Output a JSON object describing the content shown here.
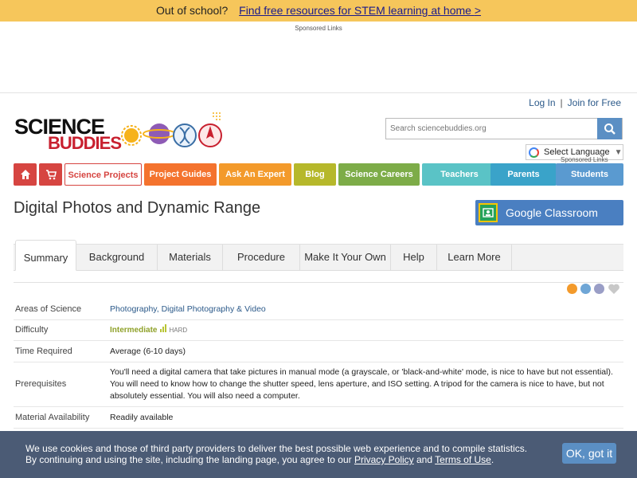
{
  "promo": {
    "prefix": "Out of school?",
    "link": "Find free resources for STEM learning at home",
    "arrow": ">"
  },
  "ads": {
    "sponsored_top": "Sponsored Links",
    "sponsored_mid": "Sponsored Links"
  },
  "header": {
    "login": "Log In",
    "separator": "|",
    "join": "Join for Free",
    "logo_word1": "SCIENCE",
    "logo_word2": "BUDDIES",
    "search_placeholder": "Search sciencebuddies.org",
    "language_label": "Select Language",
    "language_caret": "▼"
  },
  "nav": [
    {
      "id": "home",
      "label": "",
      "icon": "home-icon",
      "color": "#d64541"
    },
    {
      "id": "cart",
      "label": "",
      "icon": "cart-icon",
      "color": "#d64541"
    },
    {
      "id": "science-projects",
      "label": "Science Projects",
      "color": "#ffffff",
      "text_color": "#d64541"
    },
    {
      "id": "project-guides",
      "label": "Project Guides",
      "color": "#f4732e"
    },
    {
      "id": "ask-an-expert",
      "label": "Ask An Expert",
      "color": "#f39a2b"
    },
    {
      "id": "blog",
      "label": "Blog",
      "color": "#b6b82b"
    },
    {
      "id": "science-careers",
      "label": "Science Careers",
      "color": "#7dac48"
    },
    {
      "id": "teachers",
      "label": "Teachers",
      "color": "#5ac3c6"
    },
    {
      "id": "parents",
      "label": "Parents",
      "color": "#3aa3c9"
    },
    {
      "id": "students",
      "label": "Students",
      "color": "#5a9ad0"
    }
  ],
  "page": {
    "title": "Digital Photos and Dynamic Range",
    "google_classroom": "Google Classroom"
  },
  "tabs": [
    {
      "label": "Summary",
      "active": true
    },
    {
      "label": "Background"
    },
    {
      "label": "Materials"
    },
    {
      "label": "Procedure"
    },
    {
      "label": "Make It Your Own"
    },
    {
      "label": "Help"
    },
    {
      "label": "Learn More"
    }
  ],
  "share_icons": [
    "rss-icon",
    "print-icon",
    "email-icon",
    "heart-icon"
  ],
  "summary": {
    "areas_key": "Areas of Science",
    "areas_val": "Photography, Digital Photography & Video",
    "difficulty_key": "Difficulty",
    "difficulty_level": "Intermediate",
    "difficulty_hard": "HARD",
    "time_key": "Time Required",
    "time_val": "Average (6-10 days)",
    "prereq_key": "Prerequisites",
    "prereq_val": "You'll need a digital camera that take pictures in manual mode (a grayscale, or 'black-and-white' mode, is nice to have but not essential). You will need to know how to change the shutter speed, lens aperture, and ISO setting. A tripod for the camera is nice to have, but not absolutely essential. You will also need a computer.",
    "material_key": "Material Availability",
    "material_val": "Readily available"
  },
  "cookie": {
    "line1": "We use cookies and those of third party providers to deliver the best possible web experience and to compile statistics.",
    "line2_prefix": "By continuing and using the site, including the landing page, you agree to our",
    "privacy": "Privacy Policy",
    "and": "and",
    "terms": "Terms of Use",
    "period": ".",
    "ok": "OK, got it"
  }
}
